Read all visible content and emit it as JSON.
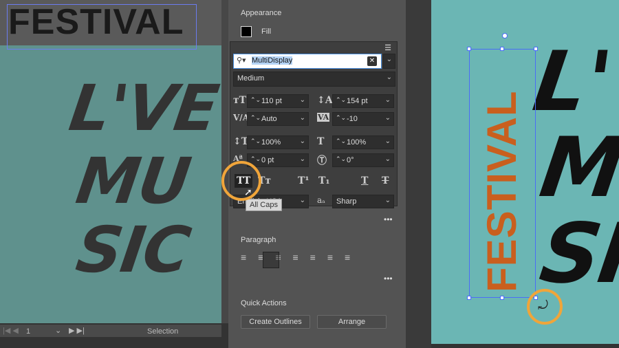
{
  "left_canvas": {
    "heading": "FESTIVAL",
    "lines": [
      "L'VE",
      "MU",
      "SIC"
    ],
    "page_number": "1",
    "status": "Selection"
  },
  "appearance": {
    "title": "Appearance",
    "fill_label": "Fill"
  },
  "character": {
    "font_family": "MultiDisplay",
    "font_style": "Medium",
    "font_size": "110 pt",
    "leading": "154 pt",
    "kerning": "Auto",
    "tracking": "-10",
    "vertical_scale": "100%",
    "horizontal_scale": "100%",
    "baseline_shift": "0 pt",
    "rotation": "0°",
    "language": "English: USA",
    "antialias": "Sharp",
    "tooltip": "All Caps",
    "all_caps_glyph": "TT",
    "small_caps_glyph": "Tт",
    "superscript_glyph": "T¹",
    "subscript_glyph": "T₁",
    "underline_glyph": "T",
    "strike_glyph": "T"
  },
  "paragraph": {
    "title": "Paragraph"
  },
  "quick_actions": {
    "title": "Quick Actions",
    "create_outlines": "Create Outlines",
    "arrange": "Arrange"
  },
  "right_canvas": {
    "vertical_text": "FESTIVAL",
    "lines": [
      "L'VE",
      "M",
      "SI"
    ]
  },
  "colors": {
    "accent": "#f0a53a",
    "festival_orange": "#c95f1e"
  }
}
